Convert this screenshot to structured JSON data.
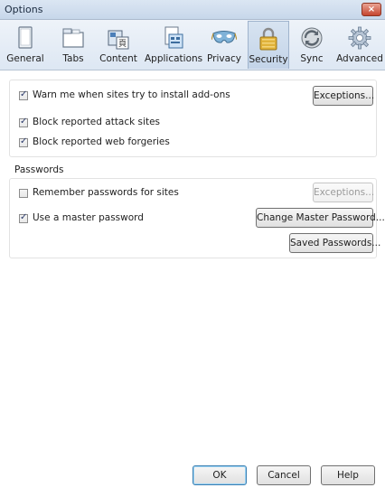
{
  "window": {
    "title": "Options",
    "close_label": "×"
  },
  "tabs": [
    {
      "label": "General",
      "icon": "window-icon"
    },
    {
      "label": "Tabs",
      "icon": "tabs-icon"
    },
    {
      "label": "Content",
      "icon": "content-icon"
    },
    {
      "label": "Applications",
      "icon": "applications-icon"
    },
    {
      "label": "Privacy",
      "icon": "mask-icon"
    },
    {
      "label": "Security",
      "icon": "padlock-icon",
      "selected": true
    },
    {
      "label": "Sync",
      "icon": "sync-icon"
    },
    {
      "label": "Advanced",
      "icon": "gear-icon"
    }
  ],
  "addons": {
    "warn_label": "Warn me when sites try to install add-ons",
    "warn_checked": true,
    "exceptions_label": "Exceptions...",
    "block_attack_label": "Block reported attack sites",
    "block_attack_checked": true,
    "block_forgeries_label": "Block reported web forgeries",
    "block_forgeries_checked": true
  },
  "passwords": {
    "caption": "Passwords",
    "remember_label": "Remember passwords for sites",
    "remember_checked": false,
    "exceptions_label": "Exceptions...",
    "master_label": "Use a master password",
    "master_checked": true,
    "change_master_label": "Change Master Password...",
    "saved_passwords_label": "Saved Passwords..."
  },
  "footer": {
    "ok_label": "OK",
    "cancel_label": "Cancel",
    "help_label": "Help"
  },
  "colors": {
    "titlebar": "#c7d7ea",
    "close": "#c5452f",
    "selected_tab": "#c3d4e8"
  }
}
